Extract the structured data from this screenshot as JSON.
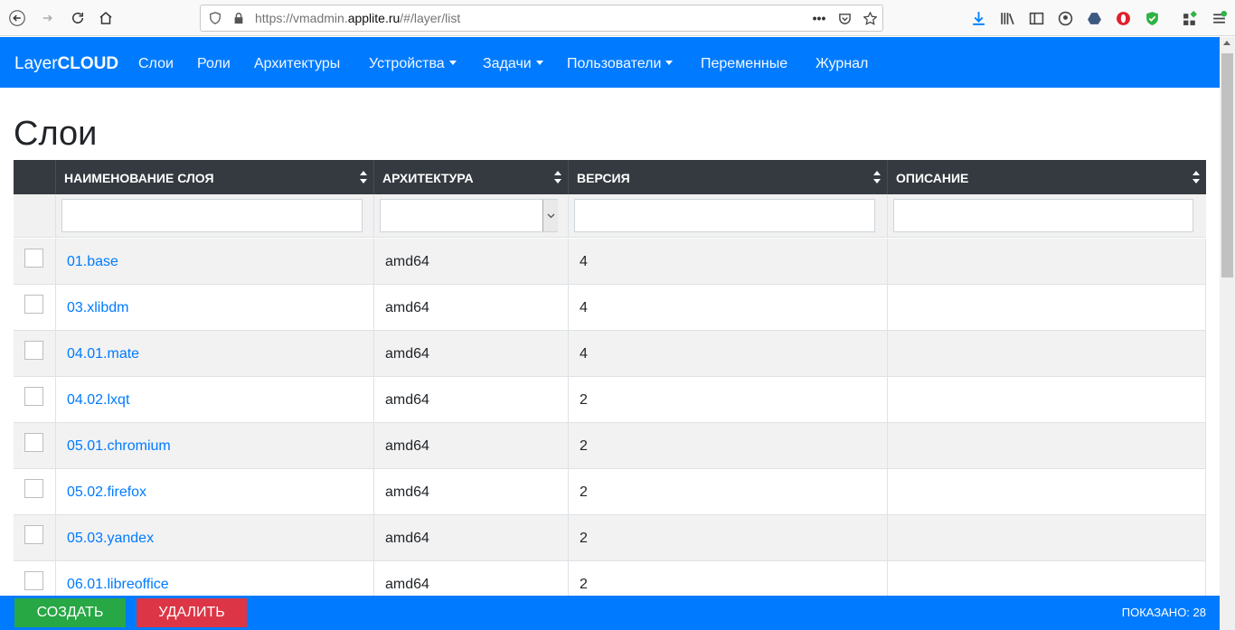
{
  "browser": {
    "url_prefix": "https://vmadmin.",
    "url_domain": "applite.ru",
    "url_suffix": "/#/layer/list",
    "more_label": "•••"
  },
  "navbar": {
    "brand_light": "Layer",
    "brand_bold": "CLOUD",
    "items": [
      {
        "label": "Слои",
        "dropdown": false
      },
      {
        "label": "Роли",
        "dropdown": false
      },
      {
        "label": "Архитектуры",
        "dropdown": false
      },
      {
        "label": "Устройства",
        "dropdown": true
      },
      {
        "label": "Задачи",
        "dropdown": true
      },
      {
        "label": "Пользователи",
        "dropdown": true
      },
      {
        "label": "Переменные",
        "dropdown": false
      },
      {
        "label": "Журнал",
        "dropdown": false
      }
    ]
  },
  "page": {
    "title": "Слои"
  },
  "table": {
    "columns": [
      {
        "label": "НАИМЕНОВАНИЕ СЛОЯ"
      },
      {
        "label": "АРХИТЕКТУРА"
      },
      {
        "label": "ВЕРСИЯ"
      },
      {
        "label": "ОПИСАНИЕ"
      }
    ],
    "filters": {
      "name": "",
      "architecture": "",
      "version": "",
      "description": ""
    },
    "rows": [
      {
        "name": "01.base",
        "architecture": "amd64",
        "version": "4",
        "description": ""
      },
      {
        "name": "03.xlibdm",
        "architecture": "amd64",
        "version": "4",
        "description": ""
      },
      {
        "name": "04.01.mate",
        "architecture": "amd64",
        "version": "4",
        "description": ""
      },
      {
        "name": "04.02.lxqt",
        "architecture": "amd64",
        "version": "2",
        "description": ""
      },
      {
        "name": "05.01.chromium",
        "architecture": "amd64",
        "version": "2",
        "description": ""
      },
      {
        "name": "05.02.firefox",
        "architecture": "amd64",
        "version": "2",
        "description": ""
      },
      {
        "name": "05.03.yandex",
        "architecture": "amd64",
        "version": "2",
        "description": ""
      },
      {
        "name": "06.01.libreoffice",
        "architecture": "amd64",
        "version": "2",
        "description": ""
      }
    ]
  },
  "footer": {
    "create_label": "СОЗДАТЬ",
    "delete_label": "УДАЛИТЬ",
    "shown_label": "ПОКАЗАНО: 28"
  },
  "colors": {
    "primary": "#007bff",
    "header_dark": "#343a40",
    "success": "#28a745",
    "danger": "#dc3545"
  }
}
